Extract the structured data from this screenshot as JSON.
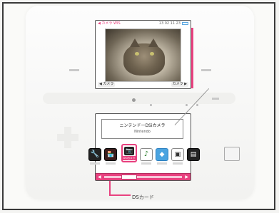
{
  "top_screen": {
    "status_left": "◀ カメラ WIS",
    "status_right": "13 02 11 23",
    "camera_left": "◀ カメラ",
    "camera_right": "カメラ ▶"
  },
  "bottom_screen": {
    "title_line1": "ニンテンドーDSiカメラ",
    "title_line2": "Nintendo",
    "apps": [
      {
        "name": "settings",
        "icon": "wrench-icon",
        "glyph": "🔧"
      },
      {
        "name": "dsi-shop",
        "icon": "shop-icon",
        "glyph": "🏪"
      },
      {
        "name": "camera",
        "icon": "camera-icon",
        "glyph": "📷",
        "label": "DSiカメラ"
      },
      {
        "name": "sound",
        "icon": "music-icon",
        "glyph": "♪"
      },
      {
        "name": "pictochat",
        "icon": "chat-icon",
        "glyph": "◆"
      },
      {
        "name": "download-play",
        "icon": "download-icon",
        "glyph": "▣"
      },
      {
        "name": "ds-card",
        "icon": "card-icon",
        "glyph": "▤"
      },
      {
        "name": "blank",
        "icon": "blank-icon",
        "glyph": ""
      }
    ]
  },
  "callout": {
    "label": "DSカード"
  },
  "colors": {
    "accent": "#e8417f",
    "frame": "#3a3a3a"
  }
}
